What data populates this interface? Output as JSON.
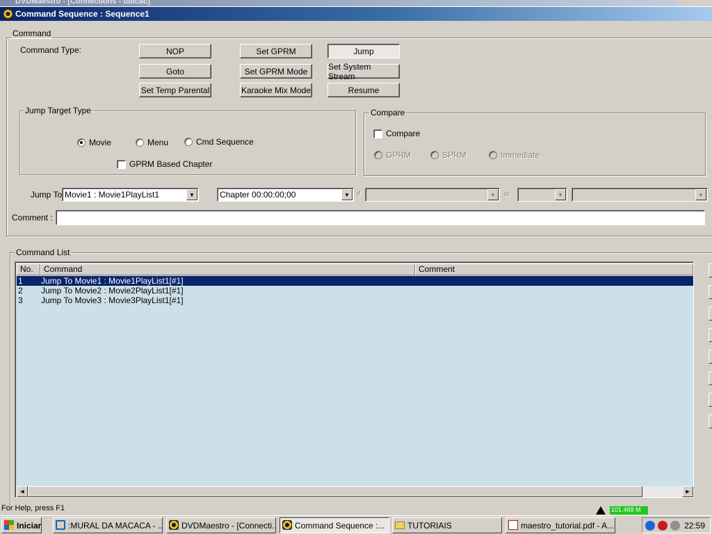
{
  "background_app": {
    "title": "DVDMaestro - [Connections - ubicac]"
  },
  "dialog": {
    "title": "Command Sequence : Sequence1"
  },
  "command": {
    "group_label": "Command",
    "type_label": "Command Type:",
    "buttons": [
      "NOP",
      "Set GPRM",
      "Jump",
      "Goto",
      "Set GPRM Mode",
      "Set System Stream",
      "Set Temp Parental",
      "Karaoke Mix Mode",
      "Resume"
    ],
    "pressed": "Jump"
  },
  "jump_target": {
    "group_label": "Jump Target Type",
    "options": [
      "Movie",
      "Menu",
      "Cmd Sequence"
    ],
    "selected": "Movie",
    "gprm_chapter_label": "GPRM Based Chapter",
    "gprm_chapter_checked": false
  },
  "compare": {
    "group_label": "Compare",
    "checkbox_label": "Compare",
    "checked": false,
    "options": [
      "GPRM",
      "SPRM",
      "Immediate"
    ]
  },
  "jump_to": {
    "label": "Jump To",
    "target_value": "Movie1 : Movie1PlayList1",
    "chapter_value": "Chapter 00:00:00;00",
    "if_label": "if",
    "is_label": "is"
  },
  "comment": {
    "label": "Comment :",
    "value": ""
  },
  "command_list": {
    "group_label": "Command List",
    "columns": [
      "No.",
      "Command",
      "Comment"
    ],
    "rows": [
      {
        "no": "1",
        "command": "Jump To Movie1 : Movie1PlayList1[#1]",
        "comment": "",
        "selected": true
      },
      {
        "no": "2",
        "command": "Jump To Movie2 : Movie2PlayList1[#1]",
        "comment": "",
        "selected": false
      },
      {
        "no": "3",
        "command": "Jump To Movie3 : Movie3PlayList1[#1]",
        "comment": "",
        "selected": false
      }
    ]
  },
  "status_bar": {
    "text": "For Help, press F1",
    "indicator": "101.468 M"
  },
  "taskbar": {
    "start_label": "Iniciar",
    "tasks": [
      {
        "label": ":MURAL DA MACACA - ...",
        "icon": "browser-icon"
      },
      {
        "label": "DVDMaestro - [Connecti...",
        "icon": "dvdmaestro-icon"
      },
      {
        "label": "Command Sequence :...",
        "icon": "dvdmaestro-icon",
        "active": true
      },
      {
        "label": "TUTORIAIS",
        "icon": "folder-icon"
      },
      {
        "label": "maestro_tutorial.pdf - A...",
        "icon": "pdf-icon"
      }
    ],
    "clock": "22:59"
  },
  "colors": {
    "title_bar_start": "#0a246a",
    "title_bar_end": "#a6caf0",
    "list_background": "#cde0e8",
    "selection": "#0a246a",
    "face": "#d4d0c8"
  }
}
